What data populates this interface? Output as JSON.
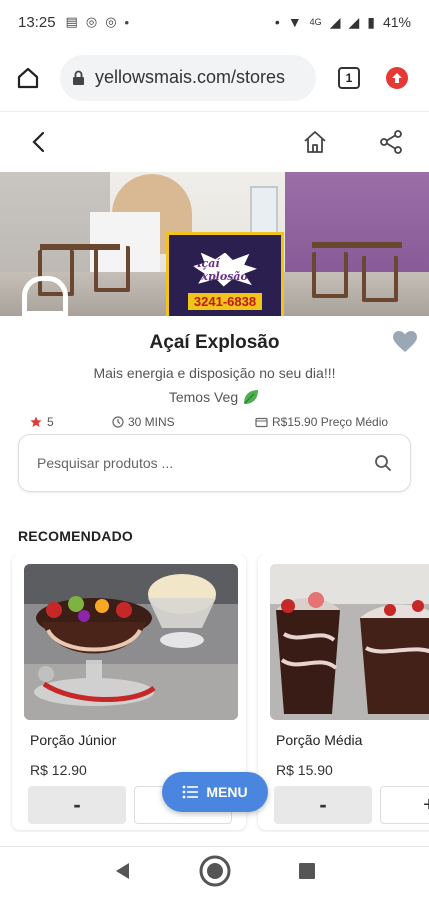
{
  "status_bar": {
    "time": "13:25",
    "network": "4G",
    "battery": "41%"
  },
  "browser": {
    "url": "yellowsmais.com/stores",
    "tab_count": "1"
  },
  "store": {
    "logo_brand": "Açaí Explosão",
    "logo_phone": "3241-6838",
    "name": "Açaí Explosão",
    "tagline": "Mais energia e disposição no seu dia!!!",
    "veg_label": "Temos Veg",
    "rating": "5",
    "delivery_time": "30 MINS",
    "avg_price": "R$15.90 Preço Médio"
  },
  "search": {
    "placeholder": "Pesquisar produtos ..."
  },
  "section": {
    "title": "RECOMENDADO"
  },
  "products": [
    {
      "name": "Porção Júnior",
      "price": "R$ 12.90",
      "minus": "-",
      "plus": "+"
    },
    {
      "name": "Porção Média",
      "price": "R$ 15.90",
      "minus": "-",
      "plus": "+"
    }
  ],
  "menu_button": {
    "label": "MENU"
  },
  "colors": {
    "accent_blue": "#4a86e0",
    "star_red": "#e53935",
    "heart_gray": "#9aa7b4"
  }
}
